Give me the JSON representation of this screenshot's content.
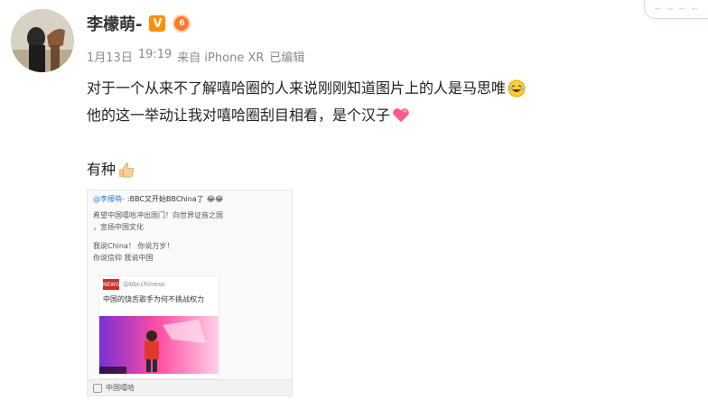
{
  "post": {
    "username": "李檬萌-",
    "meta": {
      "date": "1月13日",
      "time": "19:19",
      "source": "来自 iPhone XR",
      "edited": "已编辑"
    },
    "lines": [
      "对于一个从来不了解嘻哈圈的人来说刚刚知道图片上的人是马思唯",
      "他的这一举动让我对嘻哈圈刮目相看，是个汉子",
      "有种"
    ],
    "icons": {
      "verified": "v-verified-icon",
      "vip": "vip-level-icon",
      "laugh": "laughing-emoji-icon",
      "heart": "heart-emoji-icon",
      "thumb": "thumbs-up-emoji-icon"
    }
  },
  "image_card": {
    "mention": "@李檬萌-",
    "head_text": ":BBC又开始BBChina了",
    "body": [
      "希望中国嘻哈冲出国门！向世界证音之国",
      "，宣扬中国文化",
      "我说China！  你说万岁！",
      "你说信仰      我说中国"
    ],
    "inner_source": "@bbcchinese",
    "inner_logo": "NEWS",
    "inner_title": "中国的饶舌歌手为何不挑战权力",
    "photo_caption": "BBC NEWS",
    "footer": "中国嘻哈"
  },
  "colors": {
    "accent": "#ff8f00",
    "link": "#3a7bd5",
    "meta": "#8a8a8a"
  }
}
